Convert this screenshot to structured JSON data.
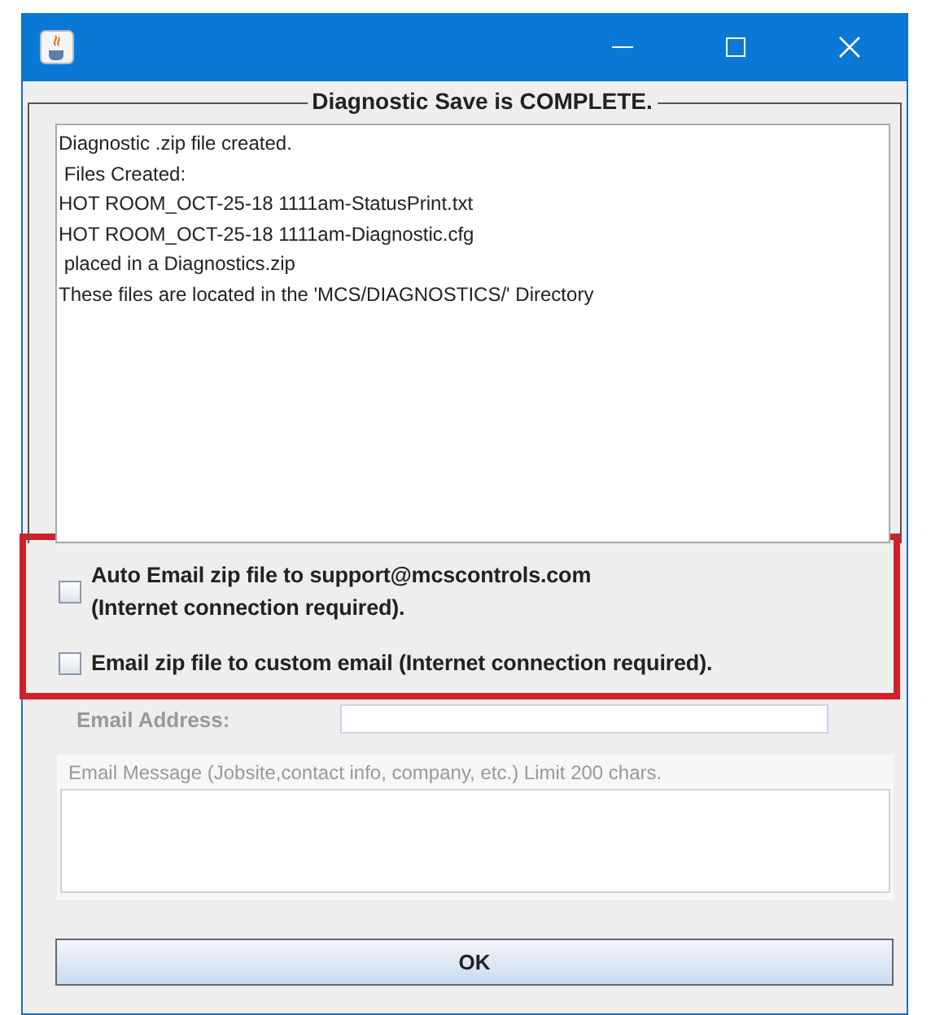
{
  "panel": {
    "legend": "Diagnostic Save is COMPLETE.",
    "log_lines": [
      "Diagnostic .zip file created.",
      " Files Created:",
      "HOT ROOM_OCT-25-18 1111am-StatusPrint.txt",
      "HOT ROOM_OCT-25-18 1111am-Diagnostic.cfg",
      " placed in a Diagnostics.zip",
      "These files are located in the 'MCS/DIAGNOSTICS/' Directory"
    ]
  },
  "options": [
    {
      "label": "Auto Email zip file to support@mcscontrols.com\n(Internet connection required).",
      "checked": false
    },
    {
      "label": "Email zip file to custom email (Internet connection required).",
      "checked": false
    }
  ],
  "email_address": {
    "label": "Email Address:",
    "disabled": true
  },
  "email_message": {
    "label": "Email Message (Jobsite,contact info, company, etc.) Limit 200 chars.",
    "disabled": true
  },
  "ok_button": "OK"
}
